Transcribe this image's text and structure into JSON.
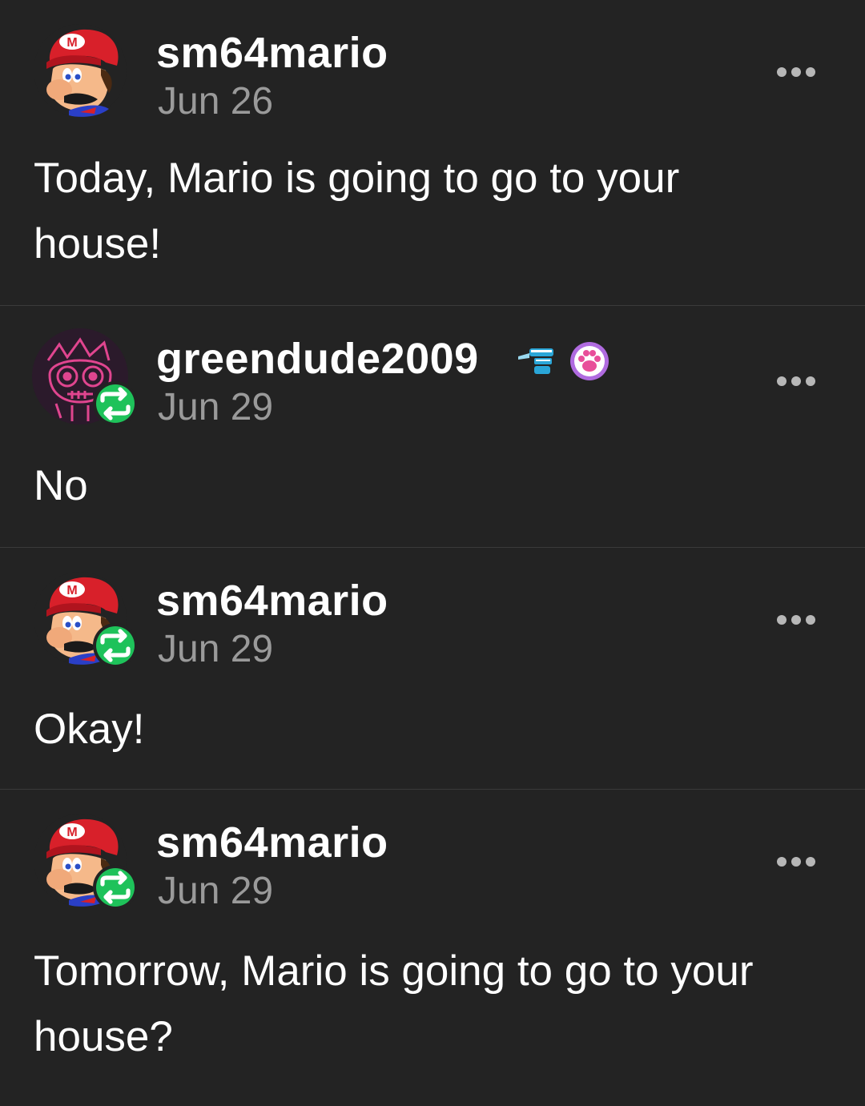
{
  "posts": [
    {
      "username": "sm64mario",
      "date": "Jun 26",
      "text": "Today, Mario is going to go to your house!",
      "reblog": false,
      "avatar_icon": "mario-avatar-icon"
    },
    {
      "username": "greendude2009",
      "date": "Jun 29",
      "text": "No",
      "reblog": true,
      "avatar_icon": "skull-avatar-icon"
    },
    {
      "username": "sm64mario",
      "date": "Jun 29",
      "text": "Okay!",
      "reblog": true,
      "avatar_icon": "mario-avatar-icon"
    },
    {
      "username": "sm64mario",
      "date": "Jun 29",
      "text": "Tomorrow, Mario is going to go to your house?",
      "reblog": true,
      "avatar_icon": "mario-avatar-icon"
    }
  ],
  "colors": {
    "background": "#232323",
    "reblog_green": "#1ec25a",
    "date_gray": "#9a9a9a"
  }
}
